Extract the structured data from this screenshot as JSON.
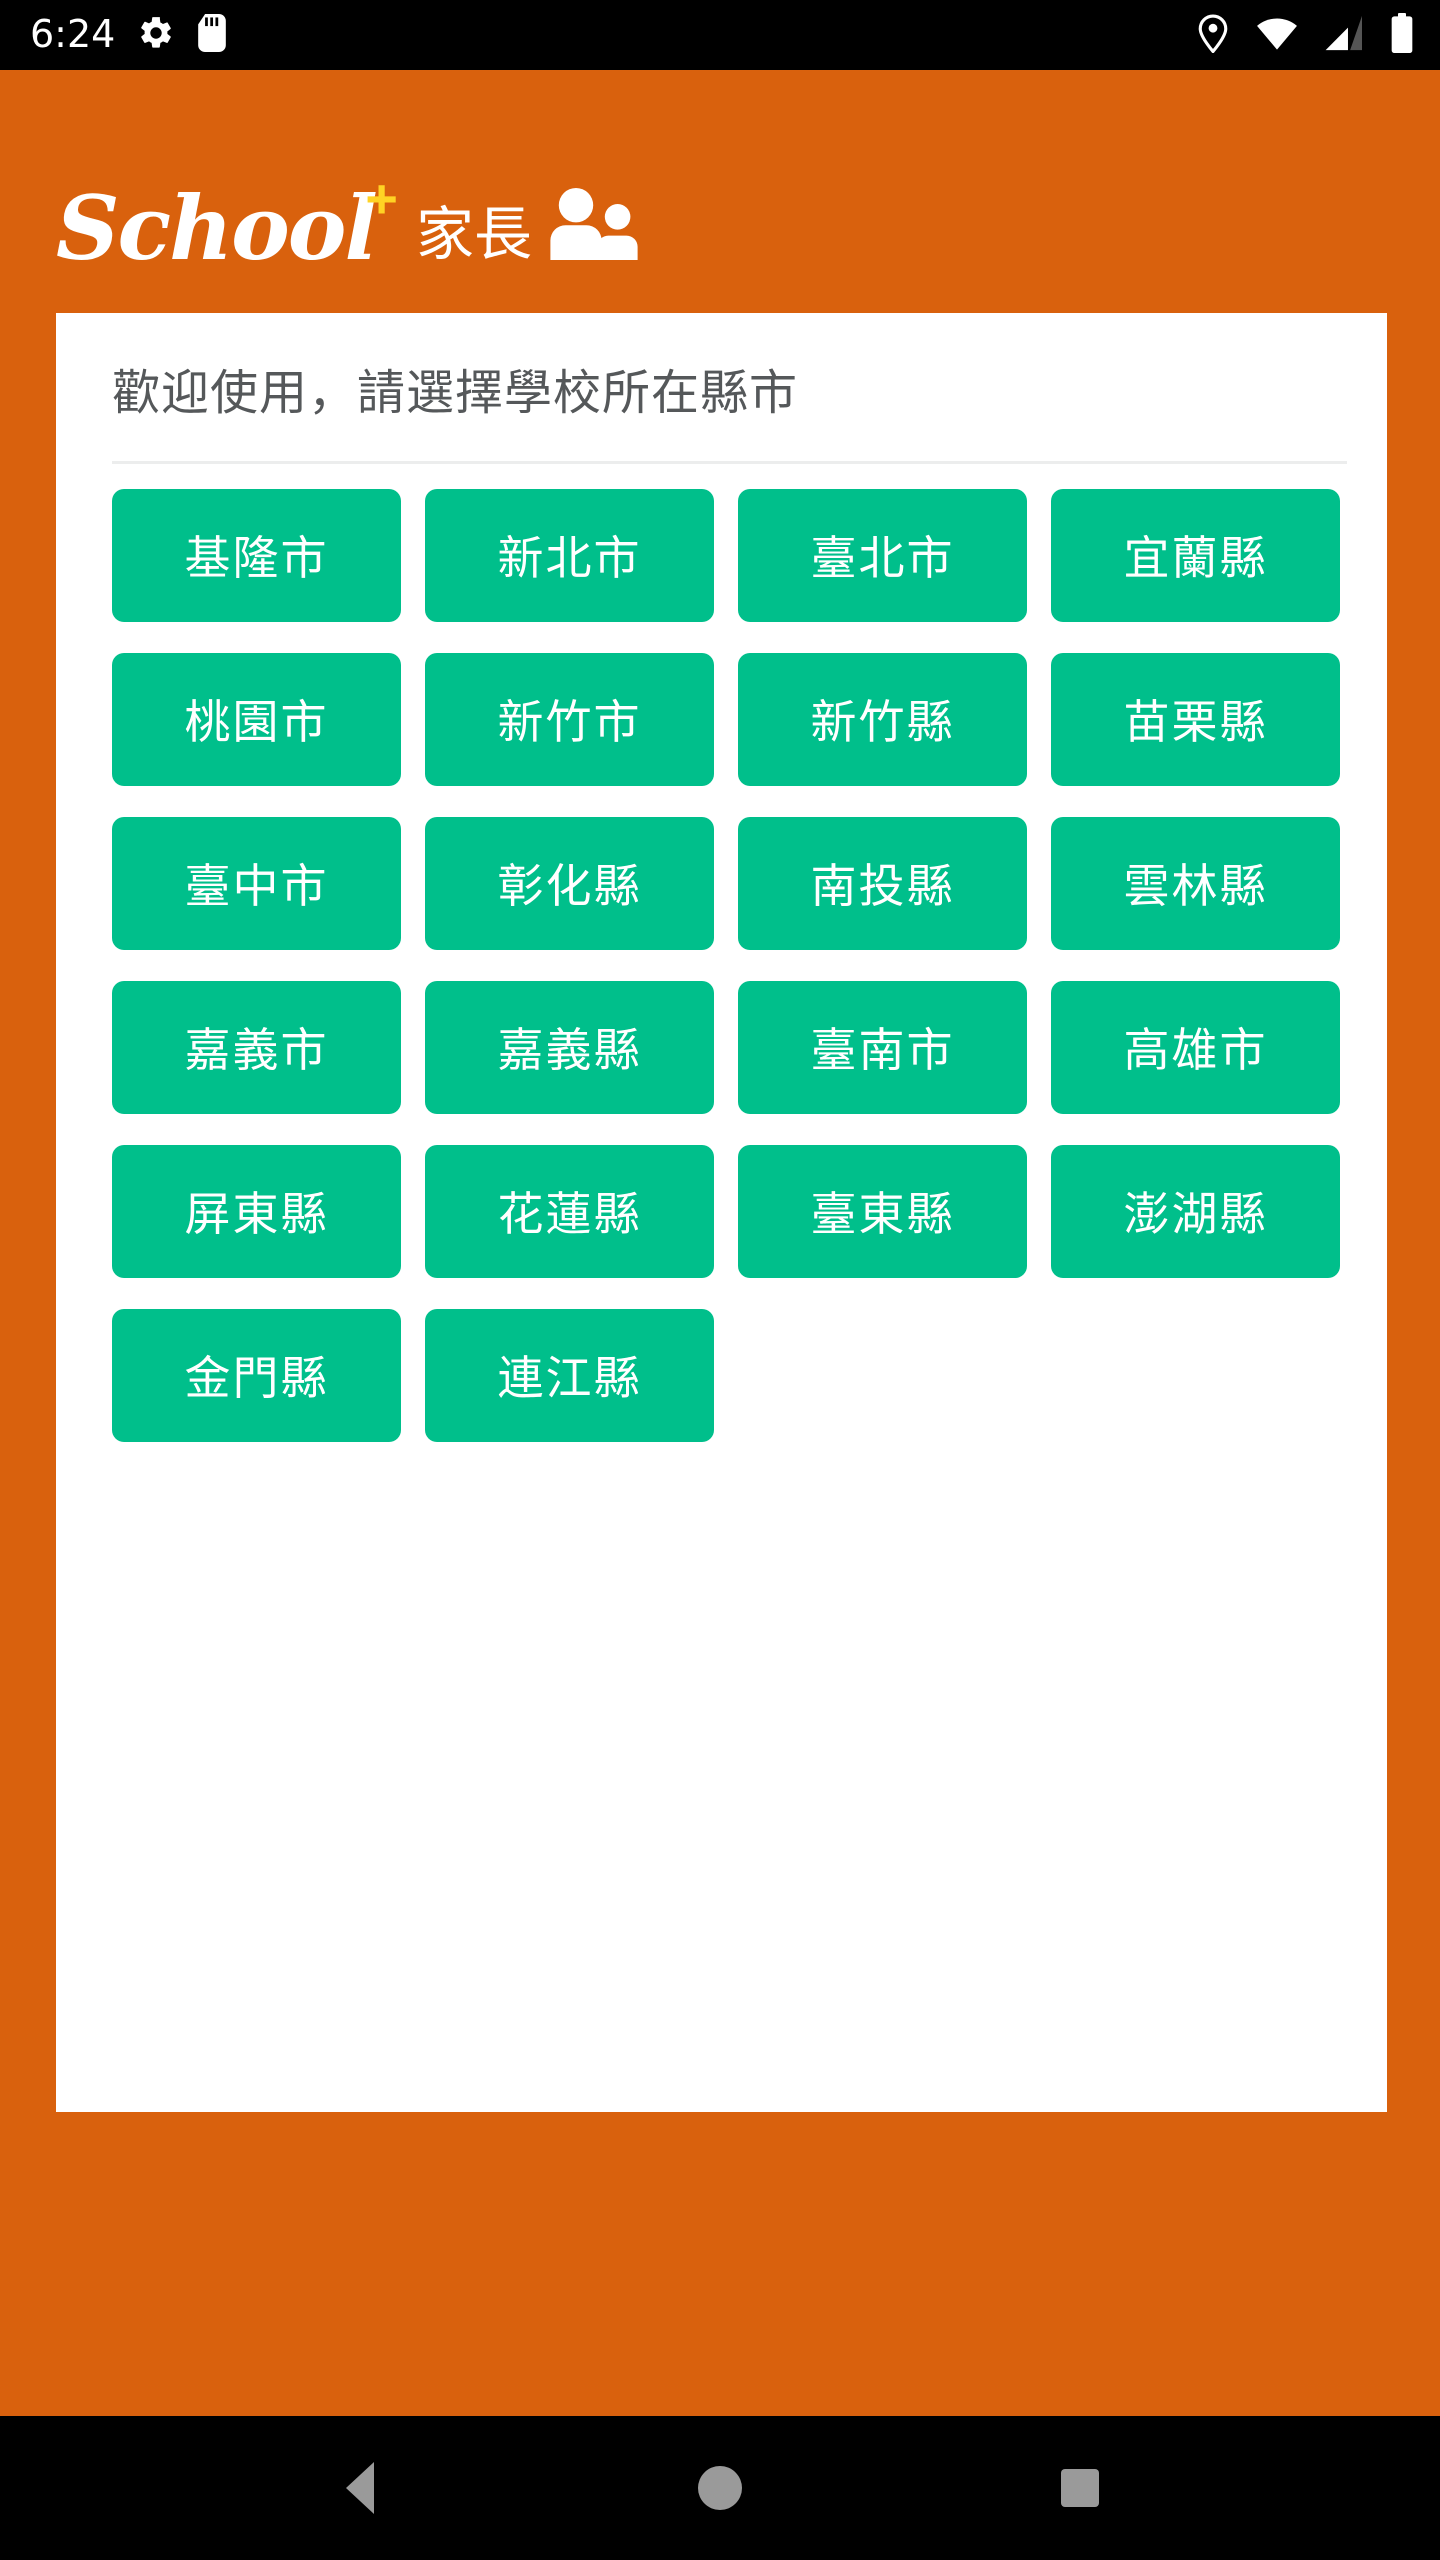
{
  "status_bar": {
    "time": "6:24",
    "left_icons": [
      "gear-icon",
      "sd-card-icon"
    ],
    "right_icons": [
      "location-pin-icon",
      "wifi-icon",
      "cellular-signal-icon",
      "battery-icon"
    ],
    "background_color": "#000000"
  },
  "header": {
    "logo_text": "School",
    "logo_plus": "+",
    "role_label": "家長",
    "role_icon": "parent-child-icon",
    "brand_color": "#d9610d",
    "plus_color": "#ffd324"
  },
  "card": {
    "title": "歡迎使用，請選擇學校所在縣市",
    "accent_color": "#00bf8b",
    "background_color": "#ffffff"
  },
  "counties": [
    "基隆市",
    "新北市",
    "臺北市",
    "宜蘭縣",
    "桃園市",
    "新竹市",
    "新竹縣",
    "苗栗縣",
    "臺中市",
    "彰化縣",
    "南投縣",
    "雲林縣",
    "嘉義市",
    "嘉義縣",
    "臺南市",
    "高雄市",
    "屏東縣",
    "花蓮縣",
    "臺東縣",
    "澎湖縣",
    "金門縣",
    "連江縣"
  ],
  "nav_bar": {
    "back": "back-icon",
    "home": "home-icon",
    "recents": "recents-icon"
  }
}
